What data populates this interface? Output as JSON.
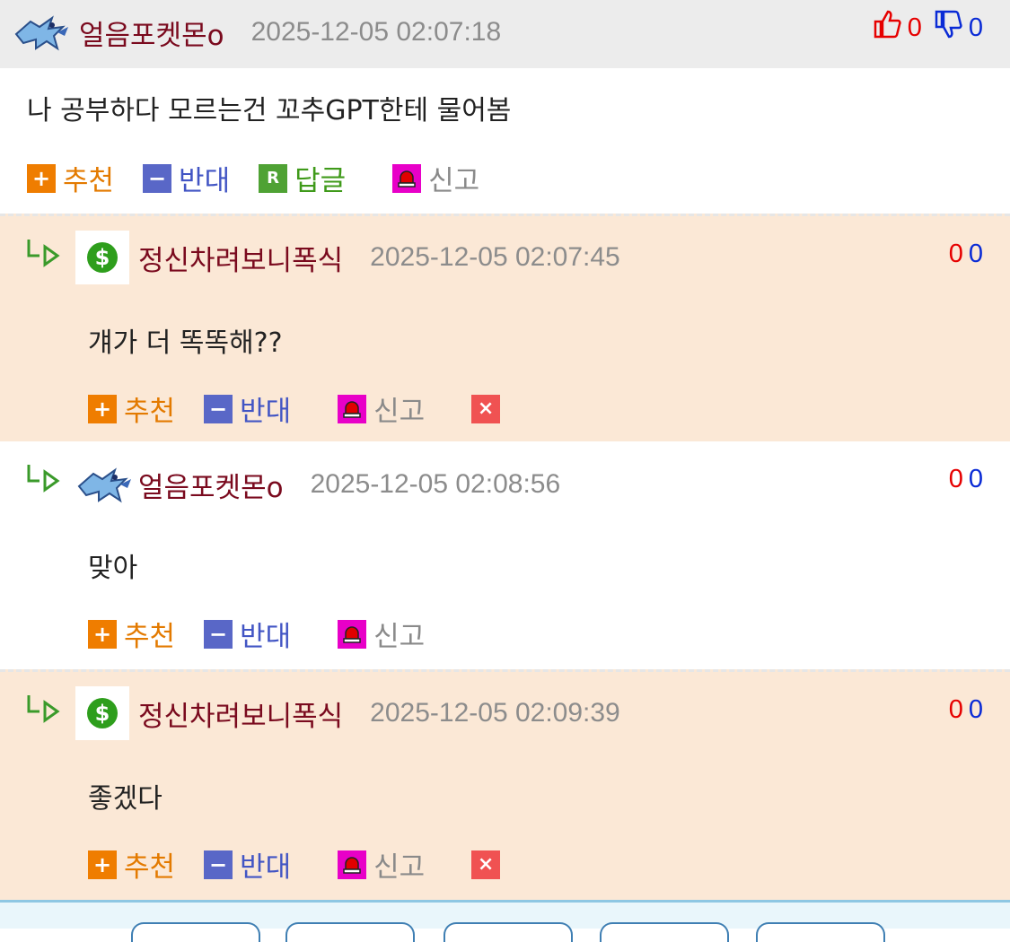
{
  "post": {
    "nickname": "얼음포켓몬o",
    "date": "2025-12-05 02:07:18",
    "up": "0",
    "down": "0",
    "content": "나 공부하다 모르는건 꼬추GPT한테 물어봄",
    "actions": {
      "recommend": "추천",
      "oppose": "반대",
      "reply": "답글",
      "report": "신고"
    }
  },
  "comments": [
    {
      "nickname": "정신차려보니폭식",
      "date": "2025-12-05 02:07:45",
      "up": "0",
      "down": "0",
      "content": "걔가 더 똑똑해??",
      "recommend": "추천",
      "oppose": "반대",
      "report": "신고"
    },
    {
      "nickname": "얼음포켓몬o",
      "date": "2025-12-05 02:08:56",
      "up": "0",
      "down": "0",
      "content": "맞아",
      "recommend": "추천",
      "oppose": "반대",
      "report": "신고"
    },
    {
      "nickname": "정신차려보니폭식",
      "date": "2025-12-05 02:09:39",
      "up": "0",
      "down": "0",
      "content": "좋겠다",
      "recommend": "추천",
      "oppose": "반대",
      "report": "신고"
    }
  ],
  "icons": {
    "avatar_ice": "ice-pokemon-avatar-icon",
    "avatar_dollar": "dollar-badge-icon",
    "reply_arrow": "reply-arrow-icon",
    "thumbs_up": "thumbs-up-icon",
    "thumbs_down": "thumbs-down-icon"
  },
  "colors": {
    "nickname": "#7a0a1e",
    "up": "#e60000",
    "down": "#0a2bd6",
    "recommend": "#e37a00",
    "oppose": "#4255c4",
    "reply": "#3f9a1a"
  }
}
